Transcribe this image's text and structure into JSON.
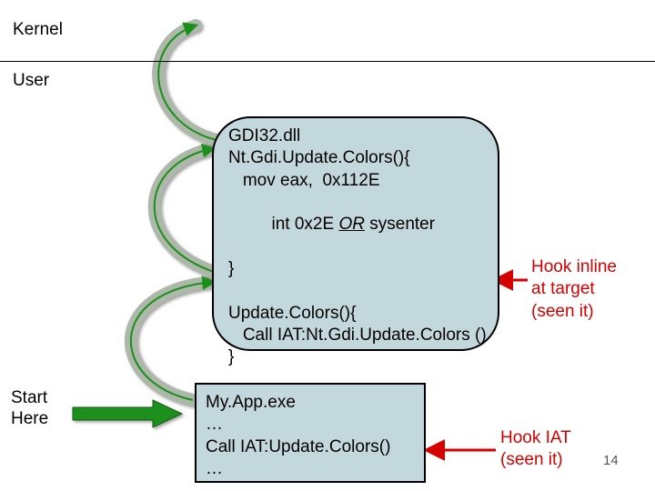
{
  "labels": {
    "kernel": "Kernel",
    "user": "User",
    "start_here": "Start\nHere",
    "hook_inline": "Hook inline\nat target\n(seen it)",
    "hook_iat": "Hook IAT\n(seen it)"
  },
  "box_main": {
    "l1": "GDI32.dll",
    "l2": "Nt.Gdi.Update.Colors(){",
    "l3": "   mov eax,  0x112E",
    "l4_a": "   int 0x2E ",
    "l4_or": "OR",
    "l4_b": " sysenter",
    "l5": "}",
    "gap": " ",
    "l6": "Update.Colors(){",
    "l7": "   Call IAT:Nt.Gdi.Update.Colors ()",
    "l8": "}"
  },
  "box_app": {
    "l1": "My.App.exe",
    "l2": "…",
    "l3": "Call IAT:Update.Colors()",
    "l4": "…"
  },
  "page_number": "14"
}
